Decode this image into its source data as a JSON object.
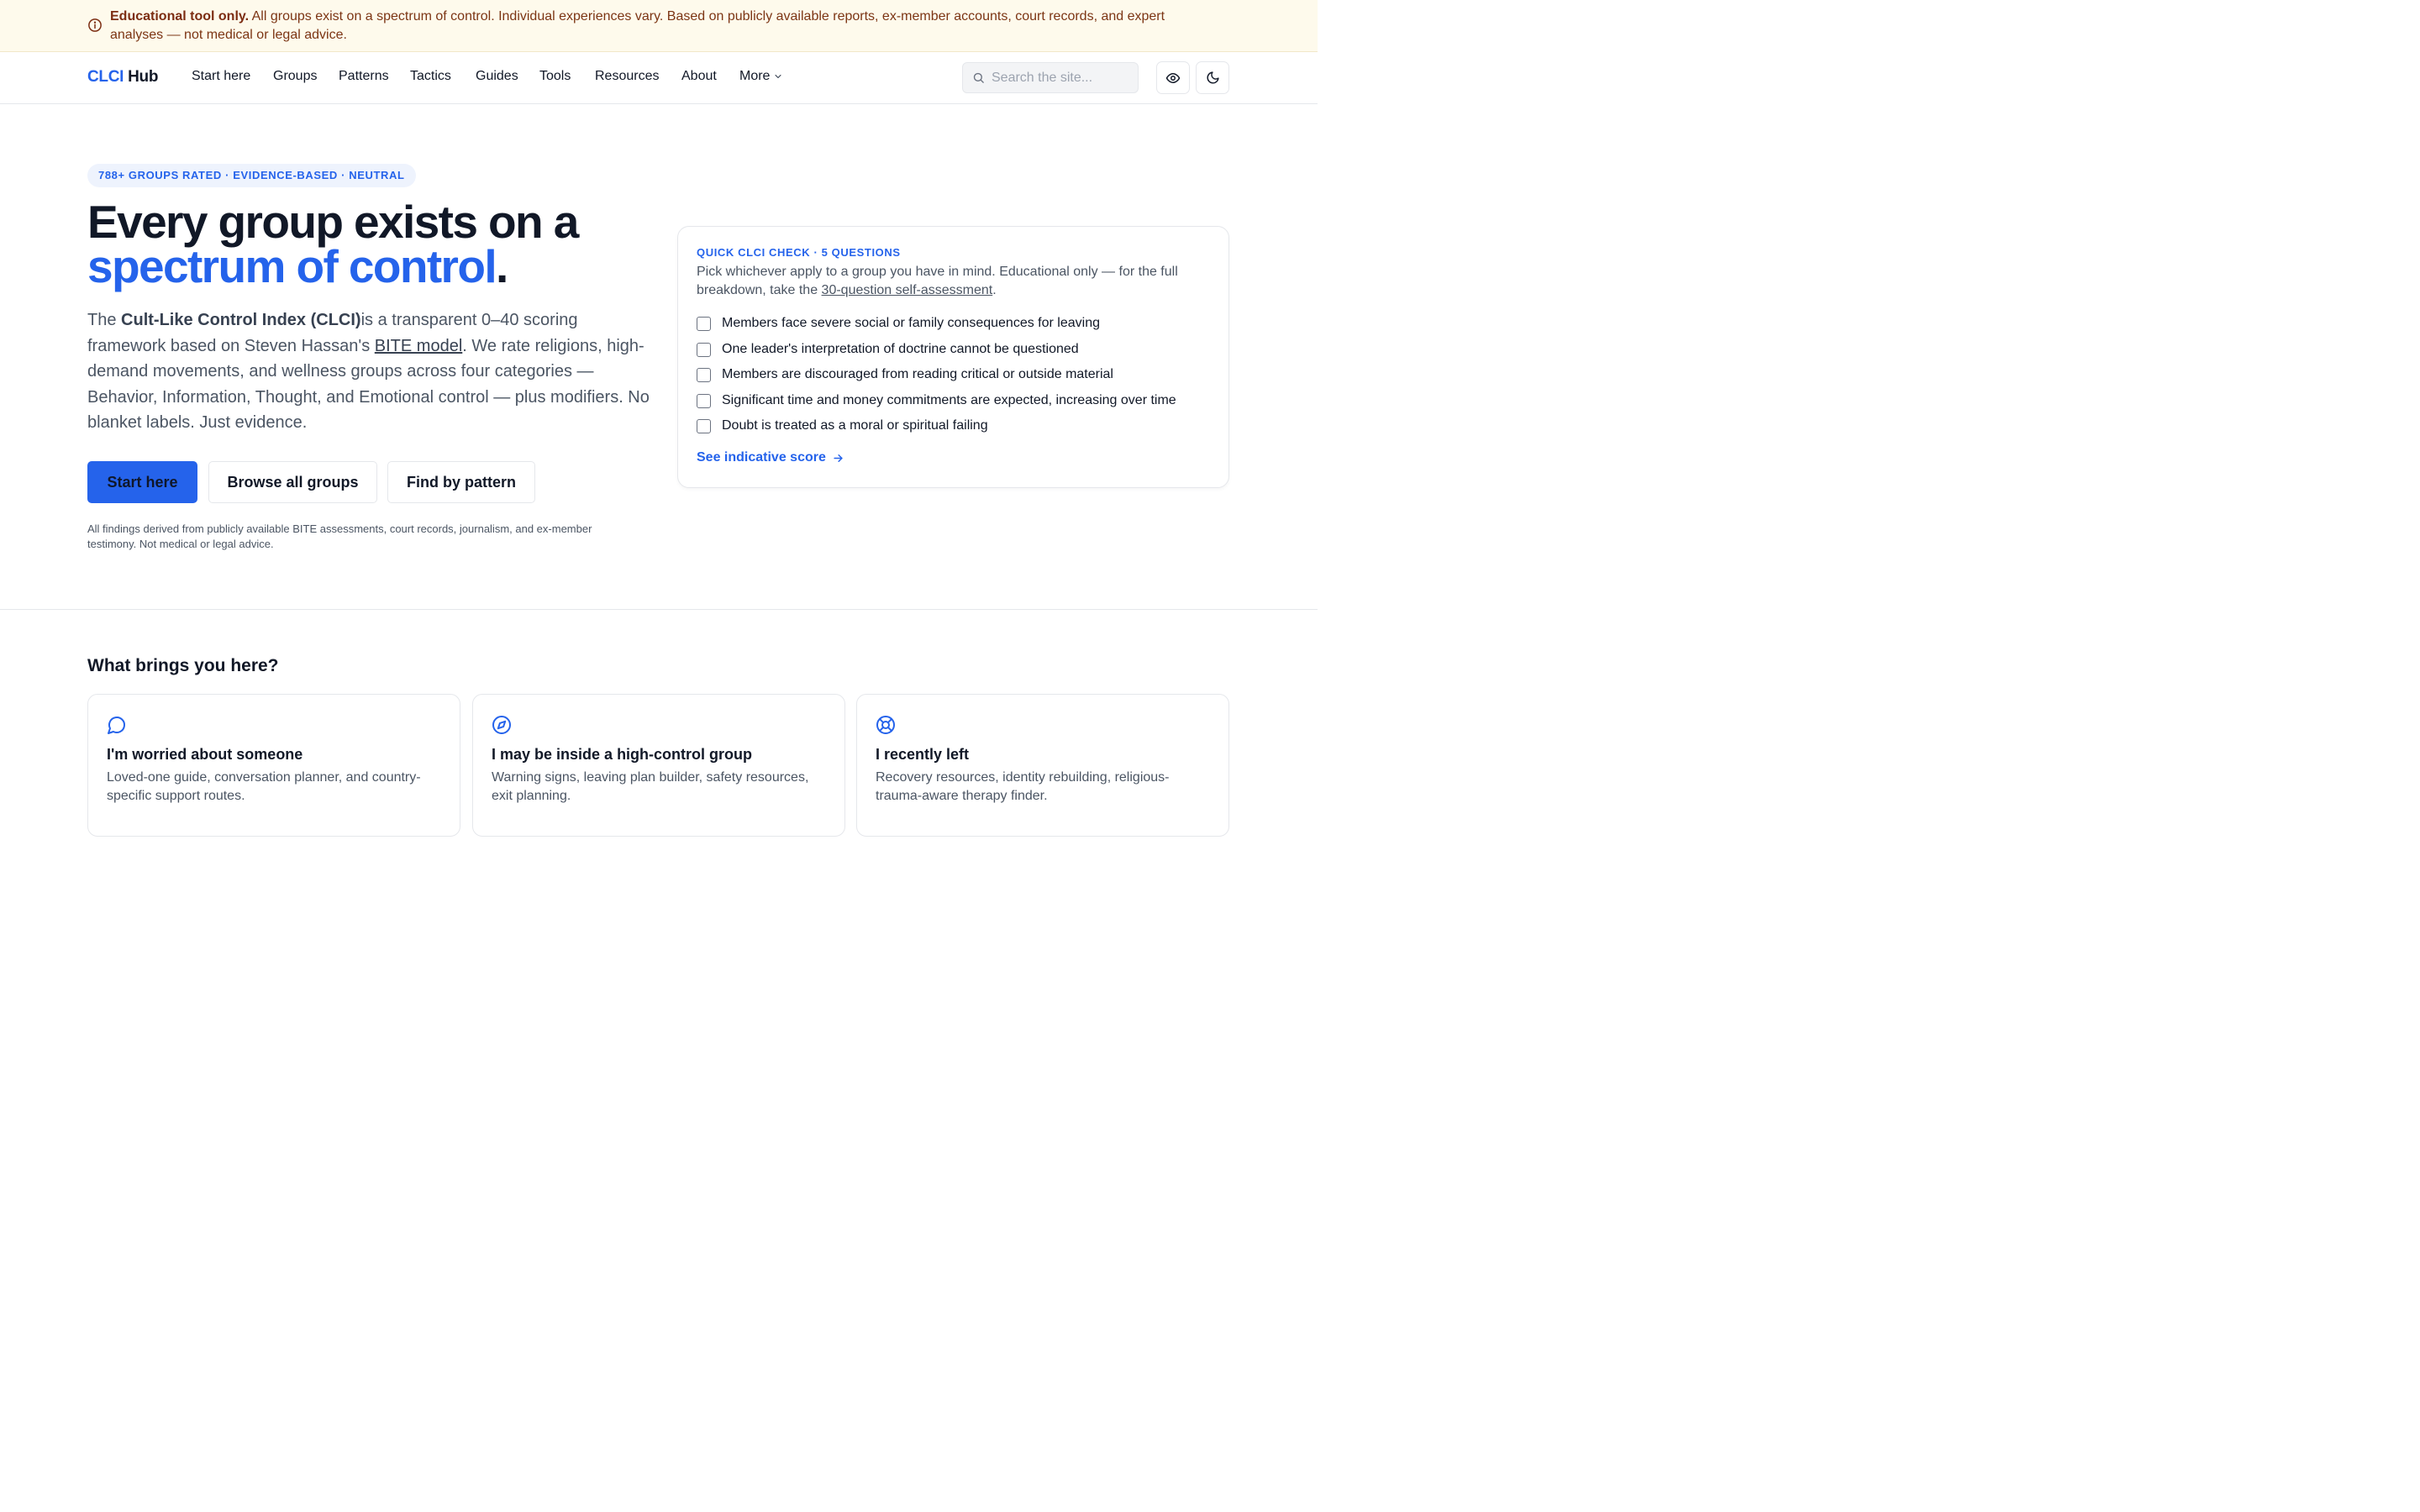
{
  "banner": {
    "icon": "info-icon",
    "bold": "Educational tool only.",
    "text": " All groups exist on a spectrum of control. Individual experiences vary. Based on publicly available reports, ex-member accounts, court records, and expert analyses — not medical or legal advice."
  },
  "header": {
    "logo_accent": "CLCI",
    "logo_rest": " Hub",
    "nav": [
      "Start here",
      "Groups",
      "Patterns",
      "Tactics",
      "Guides",
      "Tools",
      "Resources",
      "About",
      "More"
    ],
    "search_placeholder": "Search the site...",
    "icons": [
      "eye-icon",
      "moon-icon"
    ]
  },
  "hero": {
    "pill": "788+ GROUPS RATED · EVIDENCE-BASED · NEUTRAL",
    "title_line1": "Every group exists on a",
    "title_accent": "spectrum of control",
    "title_end": ".",
    "lead_pre": "The ",
    "lead_bold": "Cult-Like Control Index (CLCI)",
    "lead_mid": "is a transparent 0–40 scoring framework based on Steven Hassan's ",
    "lead_link": "BITE model",
    "lead_post": ". We rate religions, high-demand movements, and wellness groups across four categories — Behavior, Information, Thought, and Emotional control — plus modifiers. No blanket labels. Just evidence.",
    "buttons": {
      "primary": "Start here",
      "browse": "Browse all groups",
      "pattern": "Find by pattern"
    },
    "fineprint": "All findings derived from publicly available BITE assessments, court records, journalism, and ex-member testimony. Not medical or legal advice."
  },
  "quick_check": {
    "eyebrow": "QUICK CLCI CHECK · 5 QUESTIONS",
    "desc_pre": "Pick whichever apply to a group you have in mind. Educational only — for the full breakdown, take the ",
    "desc_link": "30-question self-assessment",
    "desc_post": ".",
    "items": [
      "Members face severe social or family consequences for leaving",
      "One leader's interpretation of doctrine cannot be questioned",
      "Members are discouraged from reading critical or outside material",
      "Significant time and money commitments are expected, increasing over time",
      "Doubt is treated as a moral or spiritual failing"
    ],
    "link": "See indicative score"
  },
  "section": {
    "title": "What brings you here?",
    "tiles": [
      {
        "icon": "chat-bubble-icon",
        "title": "I'm worried about someone",
        "desc": "Loved-one guide, conversation planner, and country-specific support routes."
      },
      {
        "icon": "compass-icon",
        "title": "I may be inside a high-control group",
        "desc": "Warning signs, leaving plan builder, safety resources, exit planning."
      },
      {
        "icon": "lifebuoy-icon",
        "title": "I recently left",
        "desc": "Recovery resources, identity rebuilding, religious-trauma-aware therapy finder."
      }
    ]
  },
  "colors": {
    "accent": "#2563eb",
    "banner_bg": "#fefaec",
    "banner_text": "#7c2d12"
  }
}
